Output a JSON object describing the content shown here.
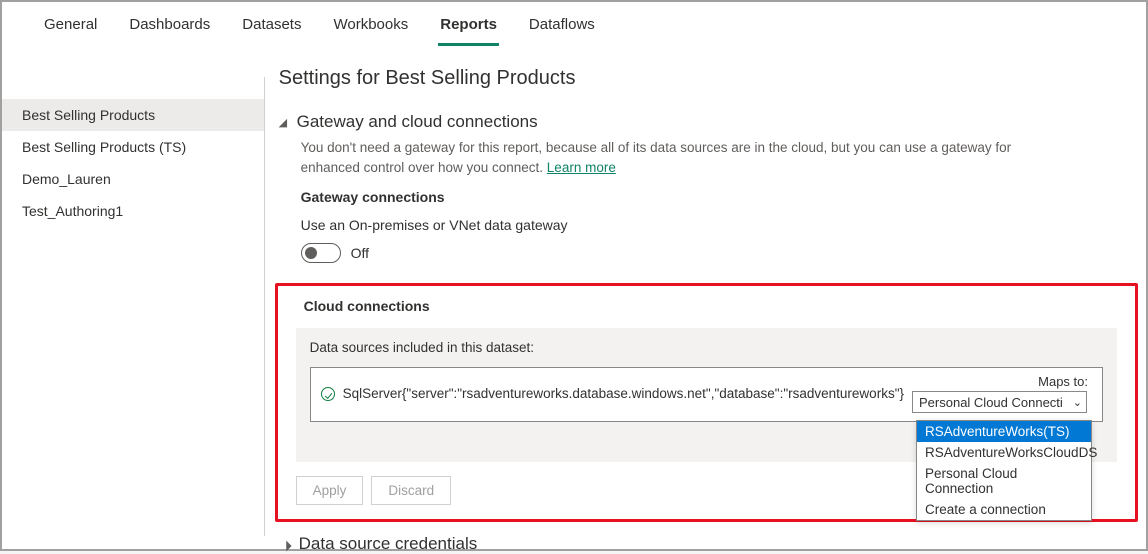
{
  "tabs": {
    "items": [
      {
        "label": "General"
      },
      {
        "label": "Dashboards"
      },
      {
        "label": "Datasets"
      },
      {
        "label": "Workbooks"
      },
      {
        "label": "Reports"
      },
      {
        "label": "Dataflows"
      }
    ]
  },
  "sidebar": {
    "items": [
      {
        "label": "Best Selling Products"
      },
      {
        "label": "Best Selling Products (TS)"
      },
      {
        "label": "Demo_Lauren"
      },
      {
        "label": "Test_Authoring1"
      }
    ]
  },
  "page": {
    "title": "Settings for Best Selling Products"
  },
  "gateway": {
    "title": "Gateway and cloud connections",
    "desc_pre": "You don't need a gateway for this report, because all of its data sources are in the cloud, but you can use a gateway for enhanced control over how you connect. ",
    "learn_more": "Learn more",
    "connections_label": "Gateway connections",
    "onprem_label": "Use an On-premises or VNet data gateway",
    "toggle_state": "Off"
  },
  "cloud": {
    "header": "Cloud connections",
    "panel_label": "Data sources included in this dataset:",
    "ds": "SqlServer{\"server\":\"rsadventureworks.database.windows.net\",\"database\":\"rsadventureworks\"}",
    "maps_to": "Maps to:",
    "selected": "Personal Cloud Connecti",
    "options": [
      "RSAdventureWorks(TS)",
      "RSAdventureWorksCloudDS",
      "Personal Cloud Connection",
      "Create a connection"
    ]
  },
  "buttons": {
    "apply": "Apply",
    "discard": "Discard"
  },
  "credentials": {
    "title": "Data source credentials"
  }
}
